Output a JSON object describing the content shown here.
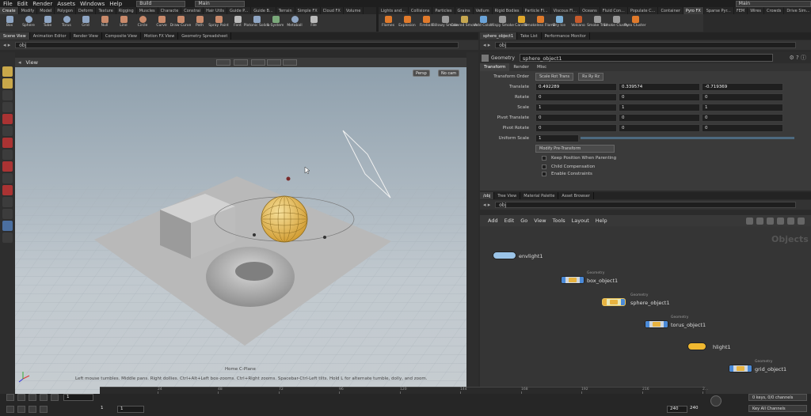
{
  "menubar": {
    "items": [
      "File",
      "Edit",
      "Render",
      "Assets",
      "Windows",
      "Help"
    ],
    "desktop": "Build",
    "workspace": "Main",
    "right_workspace": "Main"
  },
  "shelf_left": {
    "tabs": [
      "Create",
      "Modify",
      "Model",
      "Polygon",
      "Deform",
      "Texture",
      "Rigging",
      "Muscles",
      "Characte",
      "Constrai",
      "Hair Utils",
      "Guide P...",
      "Guide B...",
      "Terrain",
      "Simple FX",
      "Cloud FX",
      "Volume"
    ],
    "tools": [
      "Box",
      "Sphere",
      "Tube",
      "Torus",
      "Grid",
      "Null",
      "Line",
      "Circle",
      "Curve",
      "Draw Curve",
      "Path",
      "Spray Paint",
      "Font",
      "Platonic Solids",
      "L-System",
      "Metaball",
      "File"
    ]
  },
  "shelf_right": {
    "tabs": [
      "Lights and...",
      "Collisions",
      "Particles",
      "Grains",
      "Vellum",
      "Rigid Bodies",
      "Particle Fl...",
      "Viscous Fl...",
      "Oceans",
      "Fluid Con...",
      "Populate C...",
      "Container",
      "Pyro FX",
      "Sparse Pyr...",
      "FEM",
      "Wires",
      "Crowds",
      "Drive Sim..."
    ],
    "tools": [
      "Flames",
      "Explosion",
      "Fireball",
      "Billowy Smoke",
      "Colored Smoke",
      "Add Color",
      "Wispy Smoke",
      "Candle",
      "Smokeless Flame",
      "Dry Ice",
      "Volcano",
      "Smoke Trail",
      "Smoke Cluster",
      "Pyro Cluster"
    ]
  },
  "left_panetabs": [
    "Scene View",
    "Animation Editor",
    "Render View",
    "Composite View",
    "Motion FX View",
    "Geometry Spreadsheet"
  ],
  "right_panetabs": [
    "sphere_object1",
    "Take List",
    "Performance Monitor"
  ],
  "net_panetabs": [
    "/obj",
    "Tree View",
    "Material Palette",
    "Asset Browser"
  ],
  "path": "obj",
  "viewport": {
    "title": "View",
    "persp": "Persp",
    "cam": "No cam",
    "cplane": "Home C-Plane",
    "status": "Left mouse tumbles. Middle pans. Right dollies. Ctrl+Alt+Left box-zooms. Ctrl+Right zooms. Spacebar-Ctrl-Left tilts. Hold L for alternate tumble, dolly, and zoom."
  },
  "params": {
    "type": "Geometry",
    "name": "sphere_object1",
    "tabs": [
      "Transform",
      "Render",
      "Misc"
    ],
    "transform_order": {
      "label": "Transform Order",
      "order": "Scale Rot Trans",
      "rot": "Rx Ry Rz"
    },
    "rows": [
      {
        "label": "Translate",
        "v": [
          "0.492289",
          "0.339574",
          "-0.719369"
        ]
      },
      {
        "label": "Rotate",
        "v": [
          "0",
          "0",
          "0"
        ]
      },
      {
        "label": "Scale",
        "v": [
          "1",
          "1",
          "1"
        ]
      },
      {
        "label": "Pivot Translate",
        "v": [
          "0",
          "0",
          "0"
        ]
      },
      {
        "label": "Pivot Rotate",
        "v": [
          "0",
          "0",
          "0"
        ]
      }
    ],
    "uniform_scale": {
      "label": "Uniform Scale",
      "v": "1"
    },
    "modify": "Modify Pre-Transform",
    "checks": [
      "Keep Position When Parenting",
      "Child Compensation",
      "Enable Constraints"
    ]
  },
  "network": {
    "menu": [
      "Add",
      "Edit",
      "Go",
      "View",
      "Tools",
      "Layout",
      "Help"
    ],
    "context": "Objects",
    "nodes": [
      {
        "name": "envlight1",
        "type": ""
      },
      {
        "name": "box_object1",
        "type": "Geometry"
      },
      {
        "name": "sphere_object1",
        "type": "Geometry"
      },
      {
        "name": "torus_object1",
        "type": "Geometry"
      },
      {
        "name": "hlight1",
        "type": ""
      },
      {
        "name": "grid_object1",
        "type": "Geometry"
      }
    ]
  },
  "timeline": {
    "frame": "1",
    "start": "1",
    "start2": "1",
    "end": "240",
    "end2": "240",
    "ticks": [
      "24",
      "48",
      "72",
      "96",
      "120",
      "144",
      "168",
      "192",
      "216",
      "2..."
    ],
    "keys": "0 keys, 0/0 channels",
    "keyall": "Key All Channels"
  }
}
